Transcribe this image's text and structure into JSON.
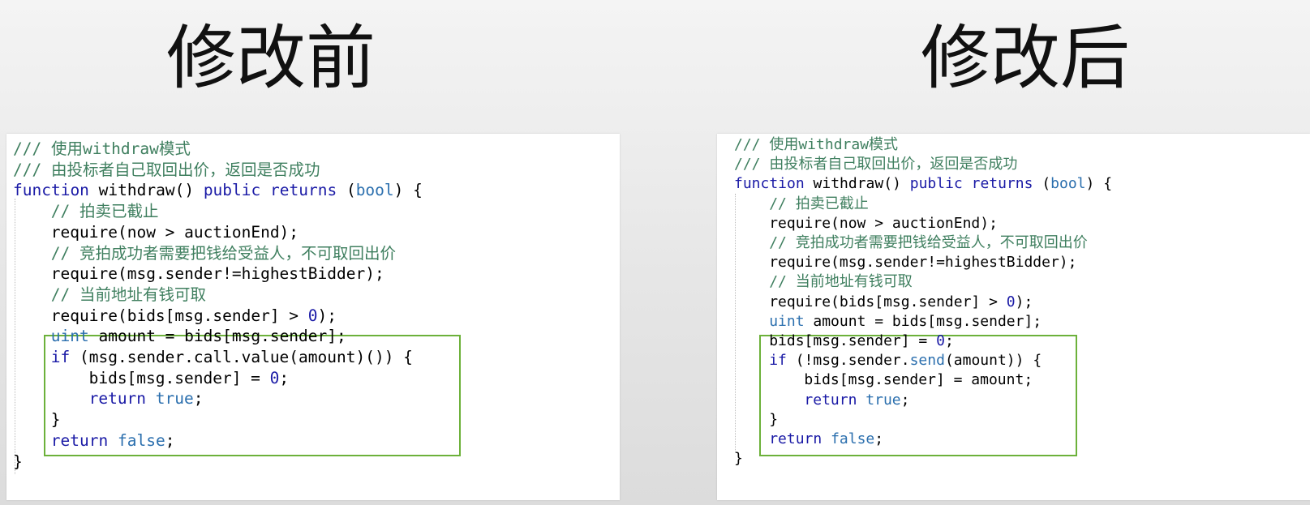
{
  "slide": {
    "title_left": "修改前",
    "title_right": "修改后"
  },
  "before": {
    "lines": [
      "/// 使用withdraw模式",
      "/// 由投标者自己取回出价，返回是否成功",
      "function withdraw() public returns (bool) {",
      "// 拍卖已截止",
      "require(now > auctionEnd);",
      "// 竞拍成功者需要把钱给受益人，不可取回出价",
      "require(msg.sender!=highestBidder);",
      "// 当前地址有钱可取",
      "require(bids[msg.sender] > 0);",
      "",
      "uint amount = bids[msg.sender];",
      "if (msg.sender.call.value(amount)()) {",
      "bids[msg.sender] = 0;",
      "return true;",
      "}",
      "return false;",
      "}"
    ]
  },
  "after": {
    "lines": [
      "/// 使用withdraw模式",
      "/// 由投标者自己取回出价，返回是否成功",
      "function withdraw() public returns (bool) {",
      "// 拍卖已截止",
      "require(now > auctionEnd);",
      "// 竞拍成功者需要把钱给受益人，不可取回出价",
      "require(msg.sender!=highestBidder);",
      "// 当前地址有钱可取",
      "require(bids[msg.sender] > 0);",
      "",
      "uint amount = bids[msg.sender];",
      "bids[msg.sender] = 0;",
      "if (!msg.sender.send(amount)) {",
      "bids[msg.sender] = amount;",
      "return true;",
      "}",
      "return false;",
      "}"
    ]
  },
  "colors": {
    "comment": "#3f7f5f",
    "keyword": "#1a1aa6",
    "type": "#2b6fae",
    "highlight_border": "#6cb13a"
  }
}
